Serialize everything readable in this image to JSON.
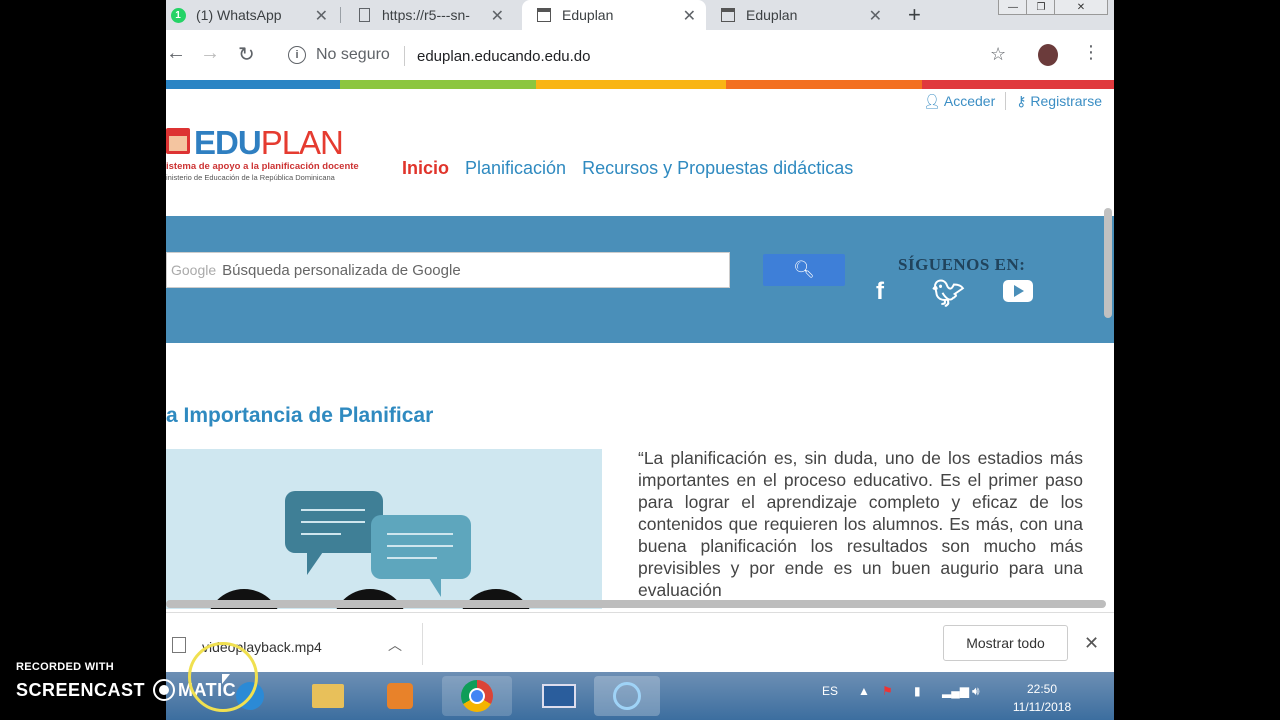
{
  "browser": {
    "tabs": [
      {
        "title": "(1) WhatsApp",
        "badge": "1"
      },
      {
        "title": "https://r5---sn-"
      },
      {
        "title": "Eduplan"
      },
      {
        "title": "Eduplan"
      }
    ],
    "security_label": "No seguro",
    "url": "eduplan.educando.edu.do"
  },
  "site": {
    "top_links": {
      "login": "Acceder",
      "register": "Registrarse"
    },
    "logo": {
      "word1": "EDU",
      "word2": "PLAN",
      "tagline1": "istema de apoyo a la planificación docente",
      "tagline2": "inisterio de Educación de la República Dominicana"
    },
    "nav": [
      "Inicio",
      "Planificación",
      "Recursos y Propuestas didácticas"
    ],
    "search": {
      "google_label": "Google",
      "placeholder": "Búsqueda personalizada de Google"
    },
    "follow_label": "SÍGUENOS EN:",
    "social_icons": [
      "facebook-icon",
      "twitter-icon",
      "youtube-icon"
    ],
    "colorbar": [
      "#2a84c4",
      "#8cc63f",
      "#f9b515",
      "#f37021",
      "#e03a3e"
    ],
    "heading": "La Importancia de Planificar",
    "heading_visible": "a Importancia de Planificar",
    "quote": "“La planificación es, sin duda, uno de los estadios más importantes en el proceso educativo. Es el primer paso para lograr el aprendizaje completo y eficaz de los contenidos que requieren los alumnos. Es más, con una buena planificación los resultados son mucho más previsibles y por ende es un buen augurio para una evaluación"
  },
  "download_bar": {
    "file": "videoplayback.mp4",
    "show_all": "Mostrar todo"
  },
  "taskbar": {
    "lang": "ES",
    "time": "22:50",
    "date": "11/11/2018"
  },
  "watermark": {
    "line1": "RECORDED WITH",
    "line2a": "SCREENCAST",
    "line2b": "MATIC"
  }
}
